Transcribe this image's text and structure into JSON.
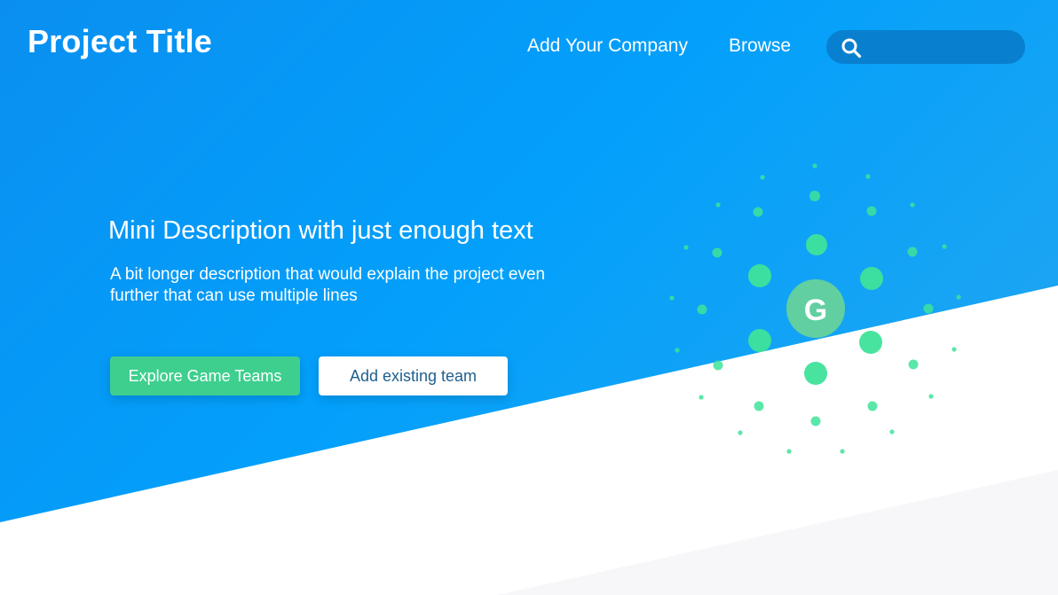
{
  "header": {
    "title": "Project Title",
    "nav": [
      "Add Your Company",
      "Browse"
    ],
    "search": {
      "placeholder": ""
    }
  },
  "hero": {
    "headline": "Mini Description with just enough text",
    "description": "A bit longer description that would explain the project even further that can use multiple lines",
    "primary_button": "Explore Game Teams",
    "secondary_button": "Add existing team"
  },
  "graphic": {
    "center_letter": "G",
    "dot_color": "#3ee39a",
    "center_color": "#61cfa0"
  },
  "colors": {
    "hero_gradient_start": "#0a8ff0",
    "hero_gradient_end": "#27a7ee",
    "accent_green": "#3ecf8e",
    "search_background": "#0880cf",
    "secondary_text": "#1e5f8f"
  },
  "icons": [
    "search-icon"
  ]
}
